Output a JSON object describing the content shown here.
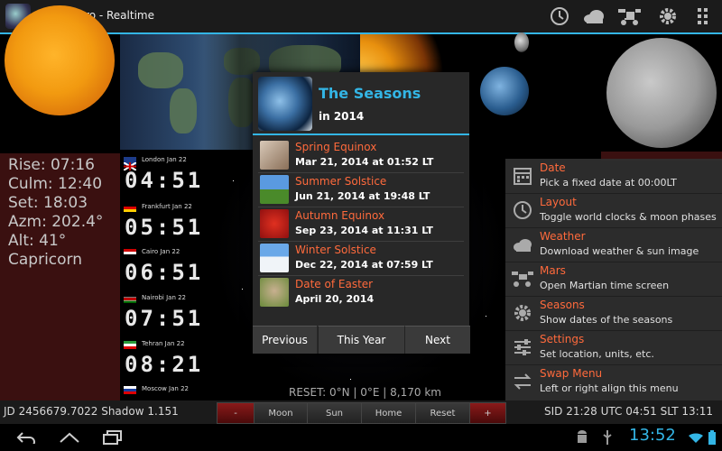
{
  "app": {
    "title": "SoLunAero - Realtime"
  },
  "actionbar": {
    "icons": [
      "clock-icon",
      "cloud-icon",
      "satellite-icon",
      "gear-icon",
      "grid-icon"
    ]
  },
  "sun": {
    "rise": "Rise: 07:16",
    "culm": "Culm: 12:40",
    "set": "Set: 18:03",
    "azm": "Azm: 202.4°",
    "alt": "Alt: 41°",
    "sign": "Capricorn"
  },
  "clocks": [
    {
      "city": "London  Jan 22",
      "time": "04:51",
      "flag": "uk"
    },
    {
      "city": "Frankfurt  Jan 22",
      "time": "05:51",
      "flag": "de"
    },
    {
      "city": "Cairo  Jan 22",
      "time": "06:51",
      "flag": "eg"
    },
    {
      "city": "Nairobi  Jan 22",
      "time": "07:51",
      "flag": "ke"
    },
    {
      "city": "Tehran  Jan 22",
      "time": "08:21",
      "flag": "ir"
    },
    {
      "city": "Moscow  Jan 22",
      "time": "",
      "flag": "ru"
    }
  ],
  "reset_text": "RESET: 0°N | 0°E | 8,170 km",
  "dialog": {
    "title": "The Seasons",
    "subtitle": "in 2014",
    "items": [
      {
        "name": "Spring Equinox",
        "date": "Mar 21, 2014 at 01:52 LT"
      },
      {
        "name": "Summer Solstice",
        "date": "Jun 21, 2014 at 19:48 LT"
      },
      {
        "name": "Autumn Equinox",
        "date": "Sep 23, 2014 at 11:31 LT"
      },
      {
        "name": "Winter Solstice",
        "date": "Dec 22, 2014 at 07:59 LT"
      },
      {
        "name": "Date of Easter",
        "date": "April 20, 2014"
      }
    ],
    "buttons": {
      "previous": "Previous",
      "this_year": "This Year",
      "next": "Next"
    }
  },
  "menu": [
    {
      "title": "Date",
      "desc": "Pick a fixed date at 00:00LT",
      "icon": "calendar-icon"
    },
    {
      "title": "Layout",
      "desc": "Toggle world clocks & moon phases",
      "icon": "clock-icon"
    },
    {
      "title": "Weather",
      "desc": "Download weather & sun image",
      "icon": "cloud-icon"
    },
    {
      "title": "Mars",
      "desc": "Open Martian time screen",
      "icon": "rover-icon"
    },
    {
      "title": "Seasons",
      "desc": "Show dates of the seasons",
      "icon": "sun-icon"
    },
    {
      "title": "Settings",
      "desc": "Set location, units, etc.",
      "icon": "sliders-icon"
    },
    {
      "title": "Swap Menu",
      "desc": "Left or right align this menu",
      "icon": "swap-icon"
    }
  ],
  "status": {
    "jd": "JD 2456679.7022  Shadow 1.151",
    "sid": "SID 21:28  UTC 04:51  SLT 13:11"
  },
  "bottom_buttons": {
    "minus": "-",
    "moon": "Moon",
    "sun": "Sun",
    "home": "Home",
    "reset": "Reset",
    "plus": "+"
  },
  "system": {
    "clock": "13:52"
  },
  "colors": {
    "accent": "#33b5e5",
    "highlight": "#ff6a3c",
    "panel_red": "#3a1010"
  }
}
